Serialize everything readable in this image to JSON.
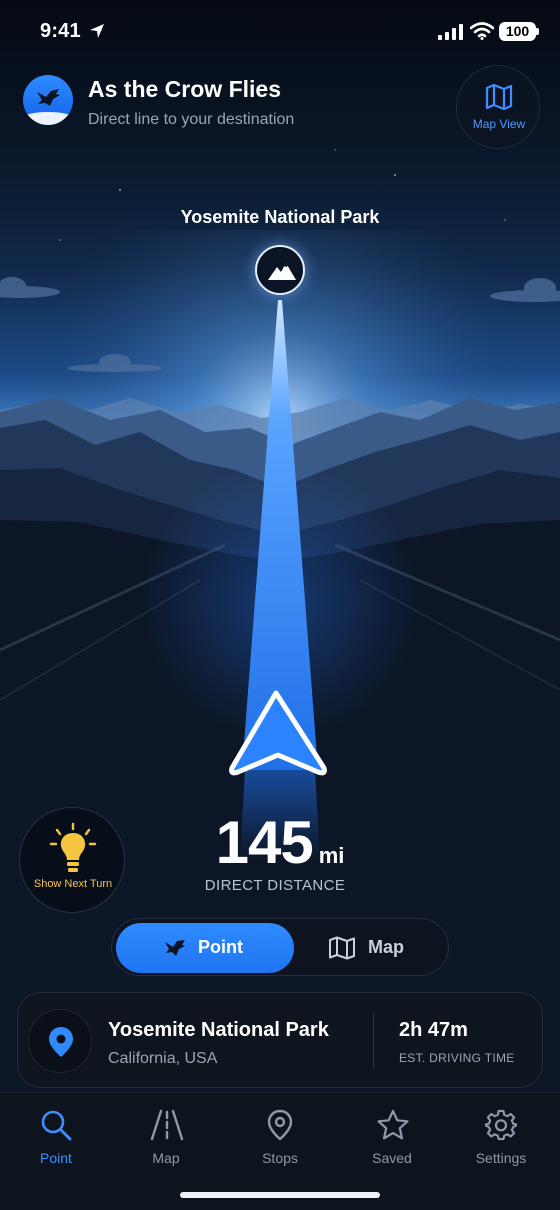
{
  "status_bar": {
    "time": "9:41",
    "battery": "100"
  },
  "header": {
    "title": "As the Crow Flies",
    "subtitle": "Direct line to your destination",
    "map_view_label": "Map View"
  },
  "destination": {
    "name": "Yosemite National Park"
  },
  "next_turn": {
    "label": "Show Next Turn"
  },
  "distance": {
    "value": "145",
    "unit": "mi",
    "caption": "DIRECT DISTANCE"
  },
  "mode_toggle": {
    "point_label": "Point",
    "map_label": "Map",
    "selected": "Point"
  },
  "card": {
    "title": "Yosemite National Park",
    "location": "California, USA",
    "drive_time": "2h 47m",
    "drive_caption": "EST. DRIVING TIME"
  },
  "tabs": [
    {
      "label": "Point",
      "icon": "search-icon",
      "active": true
    },
    {
      "label": "Map",
      "icon": "road-icon",
      "active": false
    },
    {
      "label": "Stops",
      "icon": "location-pin-icon",
      "active": false
    },
    {
      "label": "Saved",
      "icon": "star-icon",
      "active": false
    },
    {
      "label": "Settings",
      "icon": "gear-icon",
      "active": false
    }
  ],
  "colors": {
    "accent": "#2f8bff",
    "bulb": "#f5c542",
    "background": "#060b14"
  }
}
